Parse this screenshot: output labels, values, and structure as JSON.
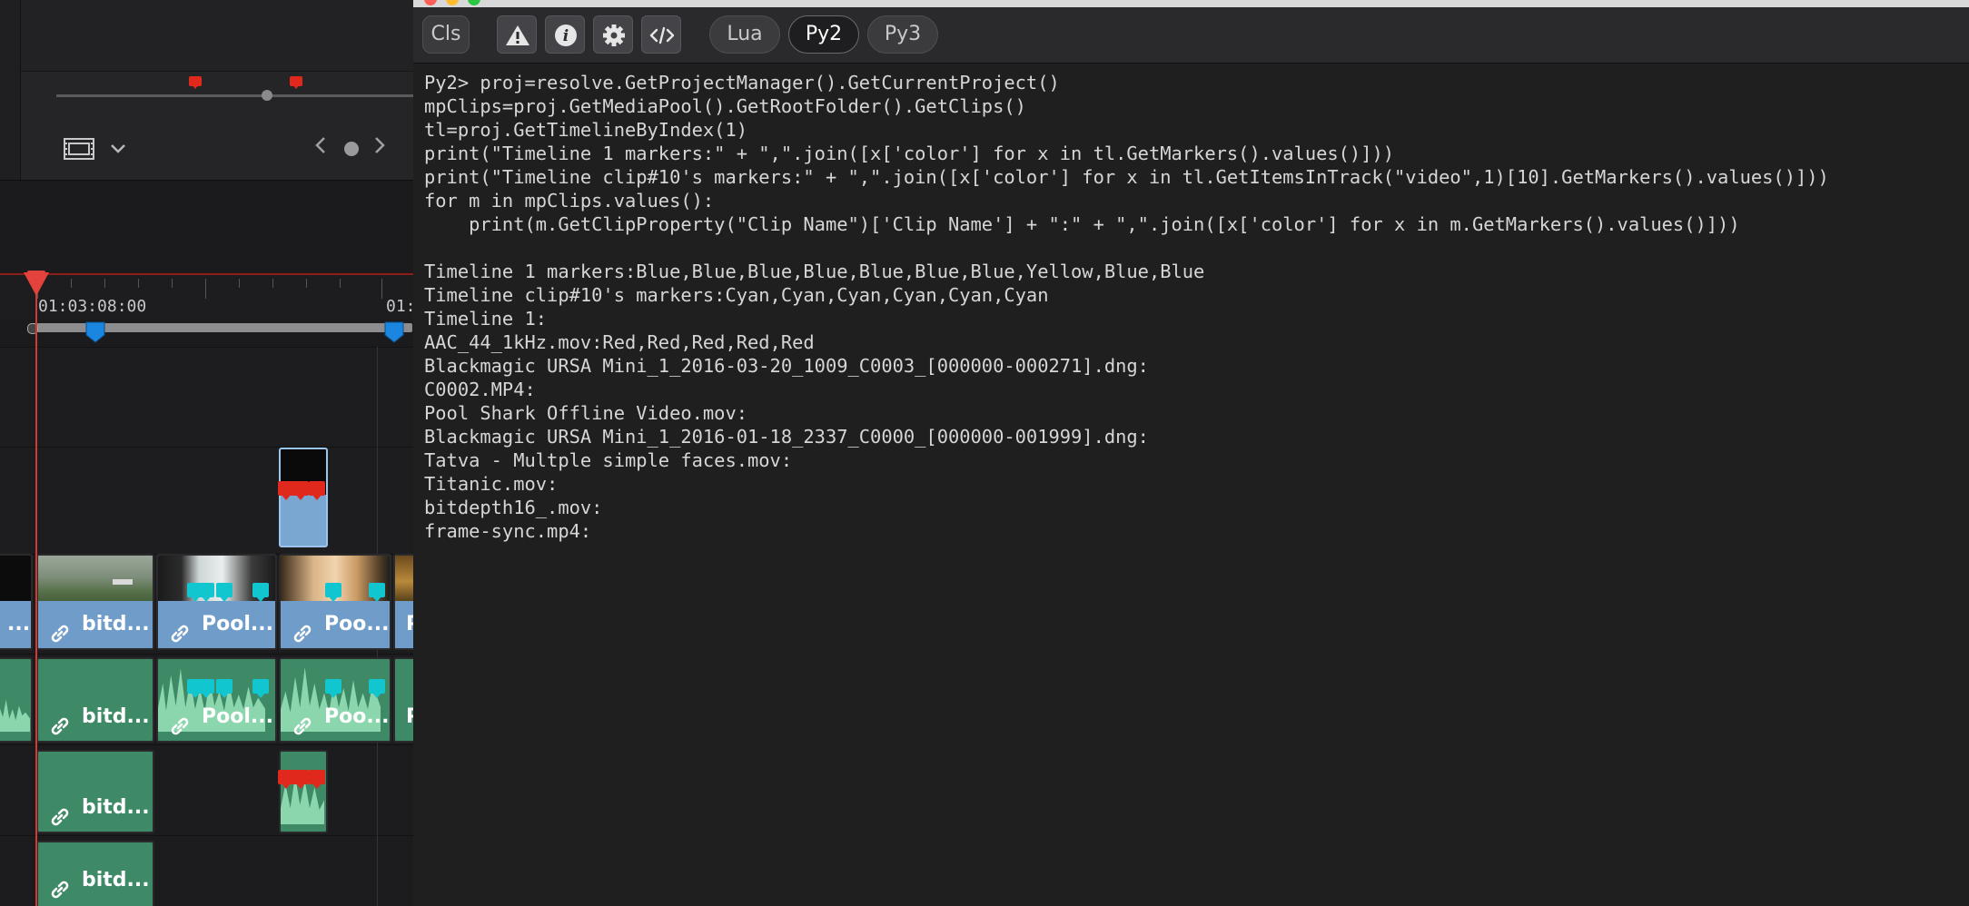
{
  "window": {
    "traffic_colors": [
      "#ff5f57",
      "#febc2e",
      "#28c840"
    ]
  },
  "timeline": {
    "timecode_primary": "01:03:08:00",
    "timecode_secondary": "01:",
    "video_clips": [
      {
        "label": "...",
        "color": "#6f9cc9"
      },
      {
        "label": "bitd...",
        "color": "#6f9cc9"
      },
      {
        "label": "Pool...",
        "color": "#6f9cc9"
      },
      {
        "label": "Poo...",
        "color": "#6f9cc9"
      },
      {
        "label": "P",
        "color": "#6f9cc9"
      }
    ],
    "audio_clips": [
      {
        "label": "bitd..."
      },
      {
        "label": "Pool..."
      },
      {
        "label": "Poo..."
      },
      {
        "label": "P"
      }
    ],
    "audio2_clips": [
      {
        "label": "bitd..."
      }
    ],
    "audio3_clips": [
      {
        "label": "bitd..."
      }
    ],
    "marker_colors": {
      "red": "#e0281c",
      "cyan": "#12c6cf",
      "blue": "#1a86e0"
    }
  },
  "console": {
    "toolbar": {
      "cls_label": "Cls",
      "warning_icon": "warning-icon",
      "info_icon": "info-icon",
      "settings_icon": "gear-icon",
      "code_icon": "code-icon",
      "tabs": [
        {
          "label": "Lua",
          "active": false
        },
        {
          "label": "Py2",
          "active": true
        },
        {
          "label": "Py3",
          "active": false
        }
      ]
    },
    "lines": [
      "Py2> proj=resolve.GetProjectManager().GetCurrentProject()",
      "mpClips=proj.GetMediaPool().GetRootFolder().GetClips()",
      "tl=proj.GetTimelineByIndex(1)",
      "print(\"Timeline 1 markers:\" + \",\".join([x['color'] for x in tl.GetMarkers().values()]))",
      "print(\"Timeline clip#10's markers:\" + \",\".join([x['color'] for x in tl.GetItemsInTrack(\"video\",1)[10].GetMarkers().values()]))",
      "for m in mpClips.values():",
      "    print(m.GetClipProperty(\"Clip Name\")['Clip Name'] + \":\" + \",\".join([x['color'] for x in m.GetMarkers().values()]))",
      "",
      "Timeline 1 markers:Blue,Blue,Blue,Blue,Blue,Blue,Blue,Yellow,Blue,Blue",
      "Timeline clip#10's markers:Cyan,Cyan,Cyan,Cyan,Cyan,Cyan",
      "Timeline 1:",
      "AAC_44_1kHz.mov:Red,Red,Red,Red,Red",
      "Blackmagic URSA Mini_1_2016-03-20_1009_C0003_[000000-000271].dng:",
      "C0002.MP4:",
      "Pool Shark Offline Video.mov:",
      "Blackmagic URSA Mini_1_2016-01-18_2337_C0000_[000000-001999].dng:",
      "Tatva - Multple simple faces.mov:",
      "Titanic.mov:",
      "bitdepth16_.mov:",
      "frame-sync.mp4:"
    ]
  }
}
